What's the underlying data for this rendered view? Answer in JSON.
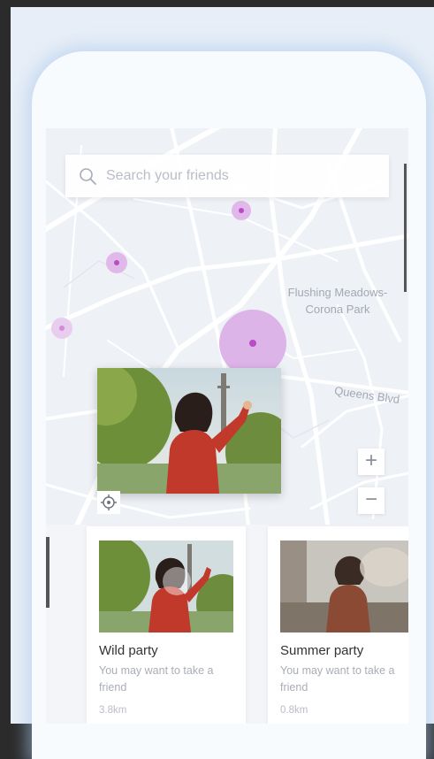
{
  "search": {
    "placeholder": "Search your friends"
  },
  "map": {
    "labels": {
      "park_line1": "Flushing Meadows-",
      "park_line2": "Corona Park",
      "street": "Queens Blvd"
    },
    "zoom_in_label": "+",
    "zoom_out_label": "−"
  },
  "colors": {
    "pin_fill": "#b84cc4",
    "pin_halo": "#e1b8ea",
    "map_bg": "#eef1f6",
    "map_road": "#ffffff"
  },
  "icons": {
    "search": "search-icon",
    "locate": "crosshair-icon"
  },
  "cards": [
    {
      "title": "Wild party",
      "description": "You may want to take a friend",
      "distance": "3.8km"
    },
    {
      "title": "Summer party",
      "description": "You may want to take a friend",
      "distance": "0.8km"
    }
  ]
}
